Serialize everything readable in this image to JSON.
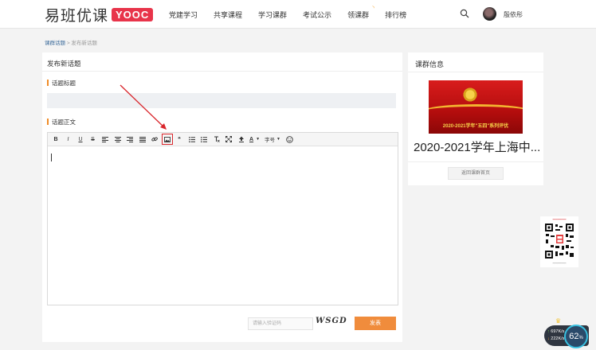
{
  "header": {
    "logo_text": "易班优课",
    "logo_badge": "YOOC",
    "nav": [
      "党建学习",
      "共享课程",
      "学习课群",
      "考试公示",
      "领课群",
      "排行榜"
    ],
    "username": "殷依彤"
  },
  "breadcrumb": {
    "link": "课群话题",
    "separator": ">",
    "current": "发布新话题"
  },
  "main": {
    "panel_title": "发布新话题",
    "title_label": "话题标题",
    "body_label": "话题正文",
    "toolbar": {
      "bold": "B",
      "italic": "I",
      "underline": "U",
      "strike": "S",
      "quote": "❝",
      "font_color": "A",
      "font_size_label": "字号"
    },
    "captcha_placeholder": "请输入验证码",
    "captcha_image_text": "WSGD",
    "submit_label": "发表"
  },
  "sidebar": {
    "title": "课群信息",
    "image_caption": "2020-2021学年\"五四\"系列评优",
    "group_name": "2020-2021学年上海中...",
    "back_button": "返回课群首页"
  },
  "widgets": {
    "upload_speed": "697K/s",
    "download_speed": "222K/s",
    "percent": "62",
    "percent_unit": "%"
  },
  "colors": {
    "accent_orange": "#f08c3c",
    "brand_red": "#e8344a",
    "highlight_red": "#d9262c"
  }
}
